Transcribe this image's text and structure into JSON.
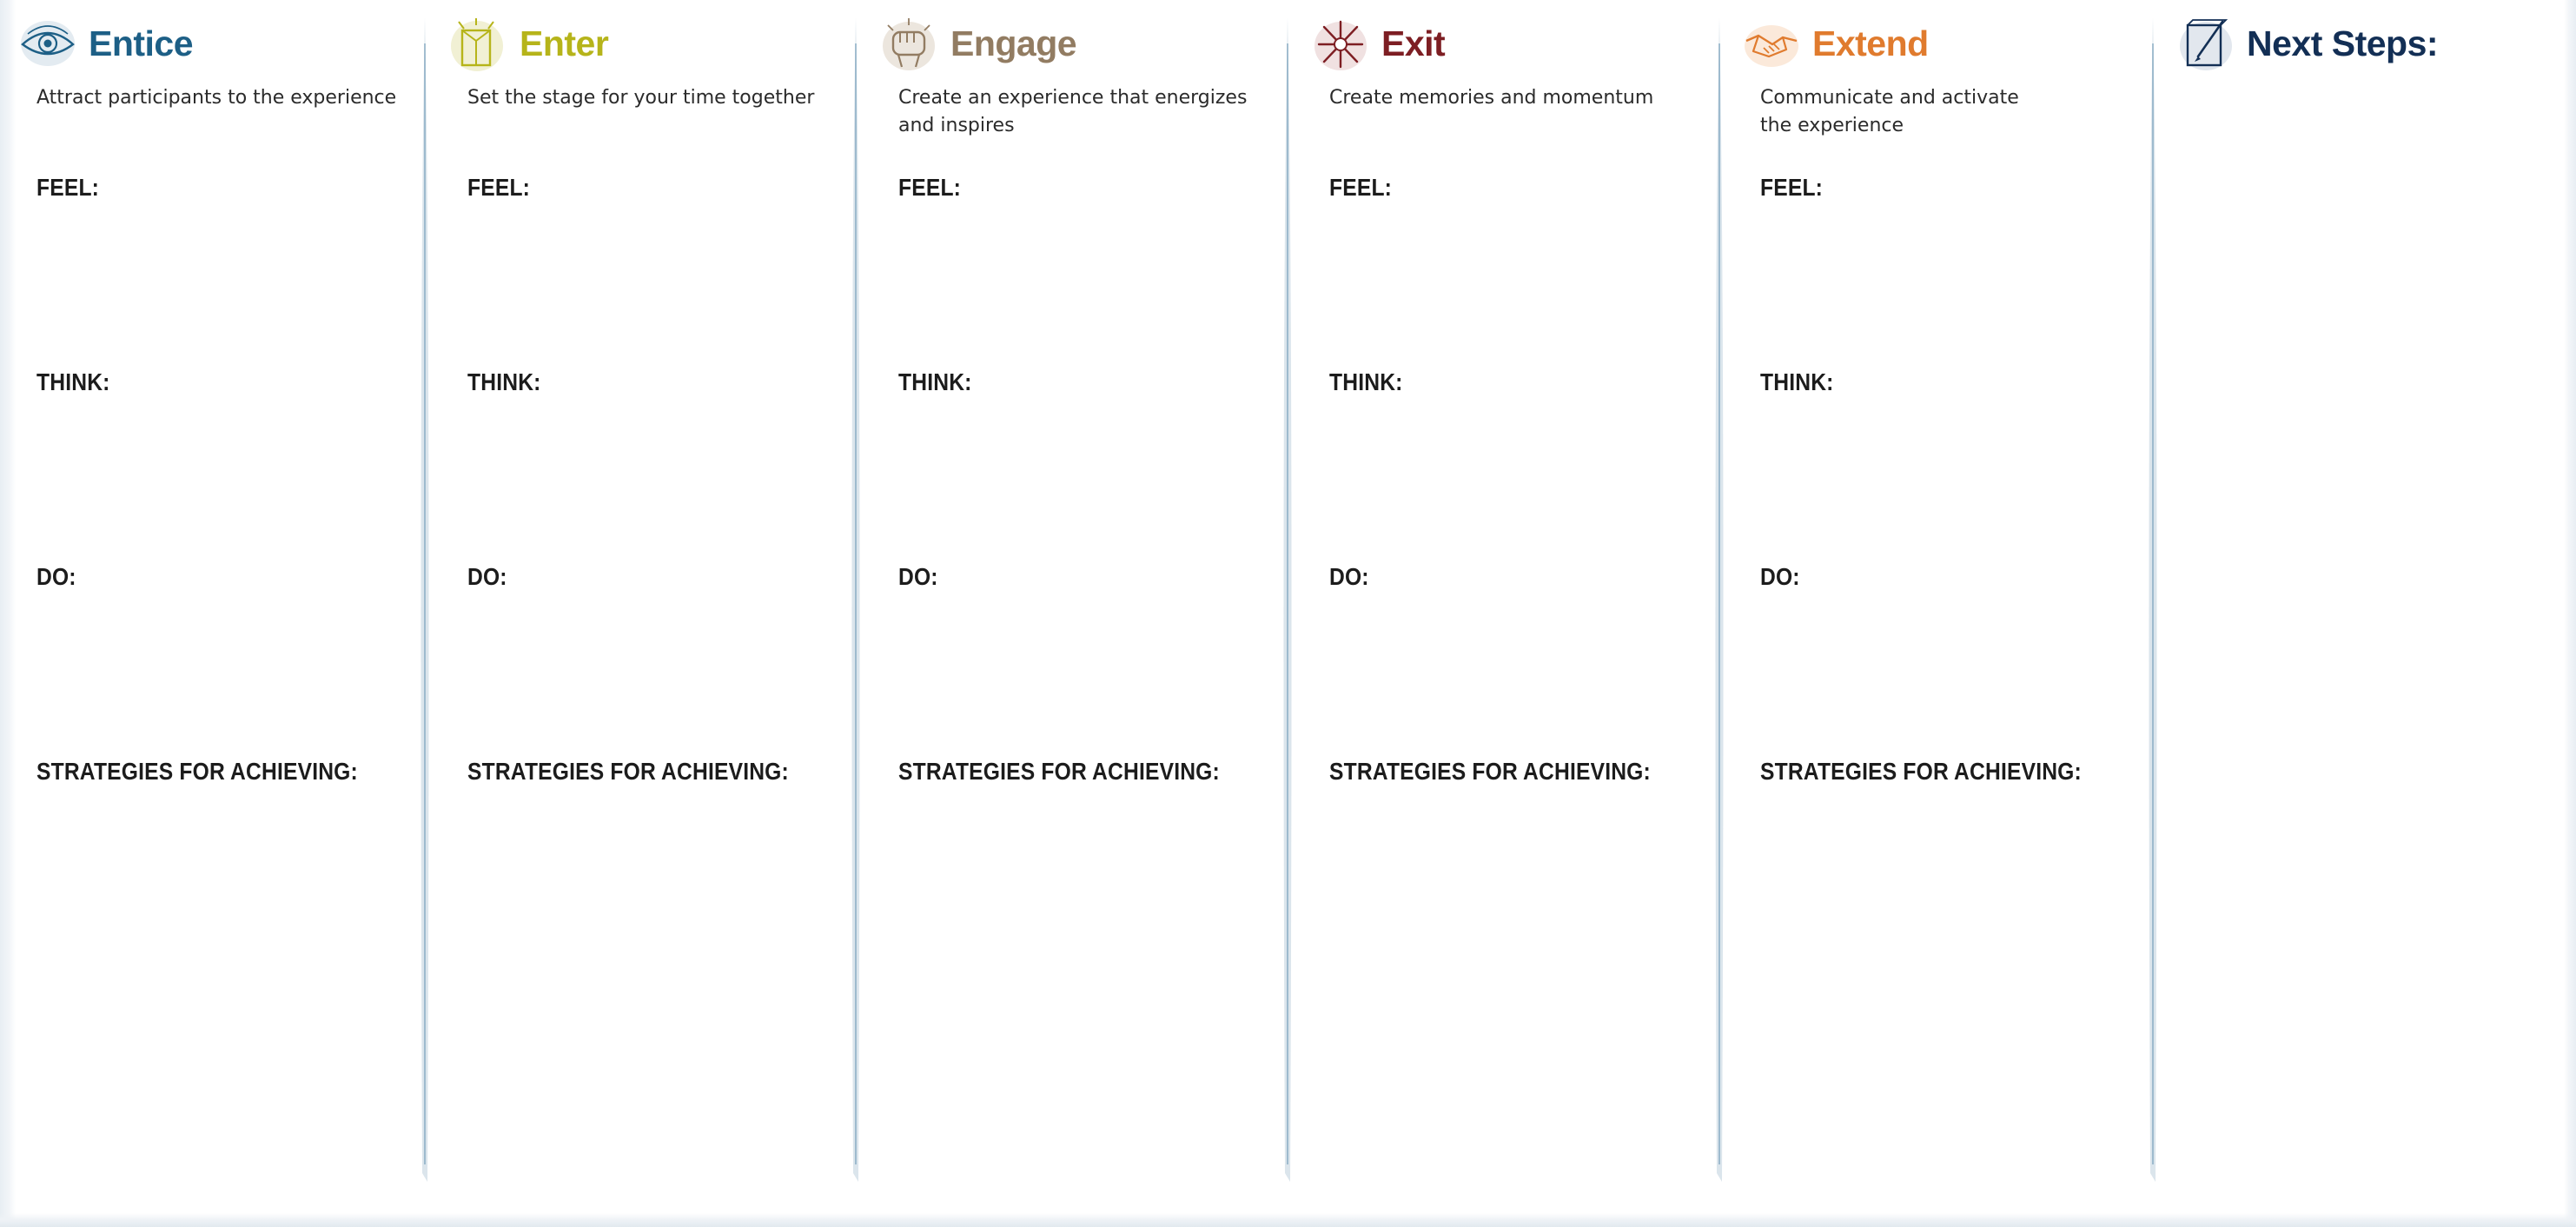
{
  "section_labels": {
    "feel": "FEEL:",
    "think": "THINK:",
    "do": "DO:",
    "strategies": "STRATEGIES FOR ACHIEVING:"
  },
  "columns": [
    {
      "title": "Entice",
      "description": "Attract participants to the experience",
      "color": "#1d5f86",
      "icon": "eye-icon"
    },
    {
      "title": "Enter",
      "description": "Set the stage for your time together",
      "color": "#b6b41a",
      "icon": "open-door-icon"
    },
    {
      "title": "Engage",
      "description": "Create an experience that energizes and inspires",
      "color": "#927c62",
      "icon": "raised-fist-icon"
    },
    {
      "title": "Exit",
      "description": "Create memories and momentum",
      "color": "#7d1e23",
      "icon": "burst-icon"
    },
    {
      "title": "Extend",
      "description": "Communicate and activate the experience",
      "color": "#e07b2e",
      "icon": "handshake-icon"
    },
    {
      "title": "Next Steps:",
      "description": "",
      "color": "#132f55",
      "icon": "notepad-pen-icon"
    }
  ]
}
